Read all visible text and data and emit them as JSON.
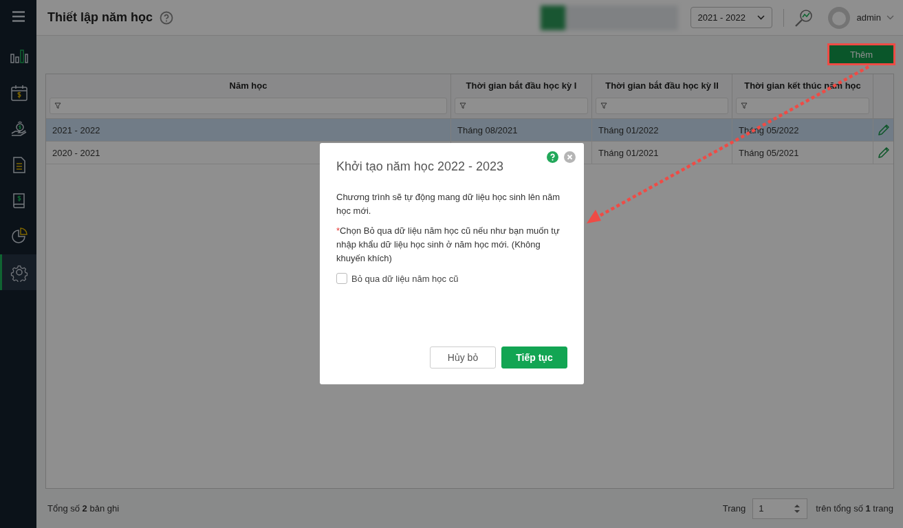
{
  "sidebar": {
    "items": [
      {
        "selected": false
      },
      {
        "selected": false
      },
      {
        "selected": false
      },
      {
        "selected": false
      },
      {
        "selected": false
      },
      {
        "selected": false
      },
      {
        "selected": true
      }
    ]
  },
  "header": {
    "title": "Thiết lập năm học",
    "year_select": "2021 - 2022",
    "user": "admin"
  },
  "toolbar": {
    "add_button": "Thêm"
  },
  "table": {
    "columns": [
      "Năm học",
      "Thời gian bắt đầu học kỳ I",
      "Thời gian bắt đầu học kỳ II",
      "Thời gian kết thúc năm học"
    ],
    "rows": [
      {
        "cells": [
          "2021 - 2022",
          "Tháng 08/2021",
          "Tháng 01/2022",
          "Tháng 05/2022"
        ],
        "selected": true
      },
      {
        "cells": [
          "2020 - 2021",
          null,
          "Tháng 01/2021",
          "Tháng 05/2021"
        ],
        "selected": false
      }
    ]
  },
  "footer": {
    "total": "Tổng số **2** bản ghi",
    "page_label": "Trang",
    "page": "1",
    "page_total": "trên tổng số **1** trang"
  },
  "dialog": {
    "title": "Khởi tạo năm học 2022 - 2023",
    "message": "Chương trình sẽ tự động mang dữ liệu học sinh lên năm học mới.",
    "note_mark": "*",
    "note": "Chọn Bỏ qua dữ liệu năm học cũ nếu như bạn muốn tự nhập khẩu dữ liệu học sinh ở năm học mới. (Không khuyến khích)",
    "checkbox": {
      "label": "Bỏ qua dữ liệu năm học cũ",
      "checked": false
    },
    "buttons": [
      {
        "label": "Hủy bỏ",
        "kind": "secondary"
      },
      {
        "label": "Tiếp tục",
        "kind": "primary"
      }
    ]
  }
}
